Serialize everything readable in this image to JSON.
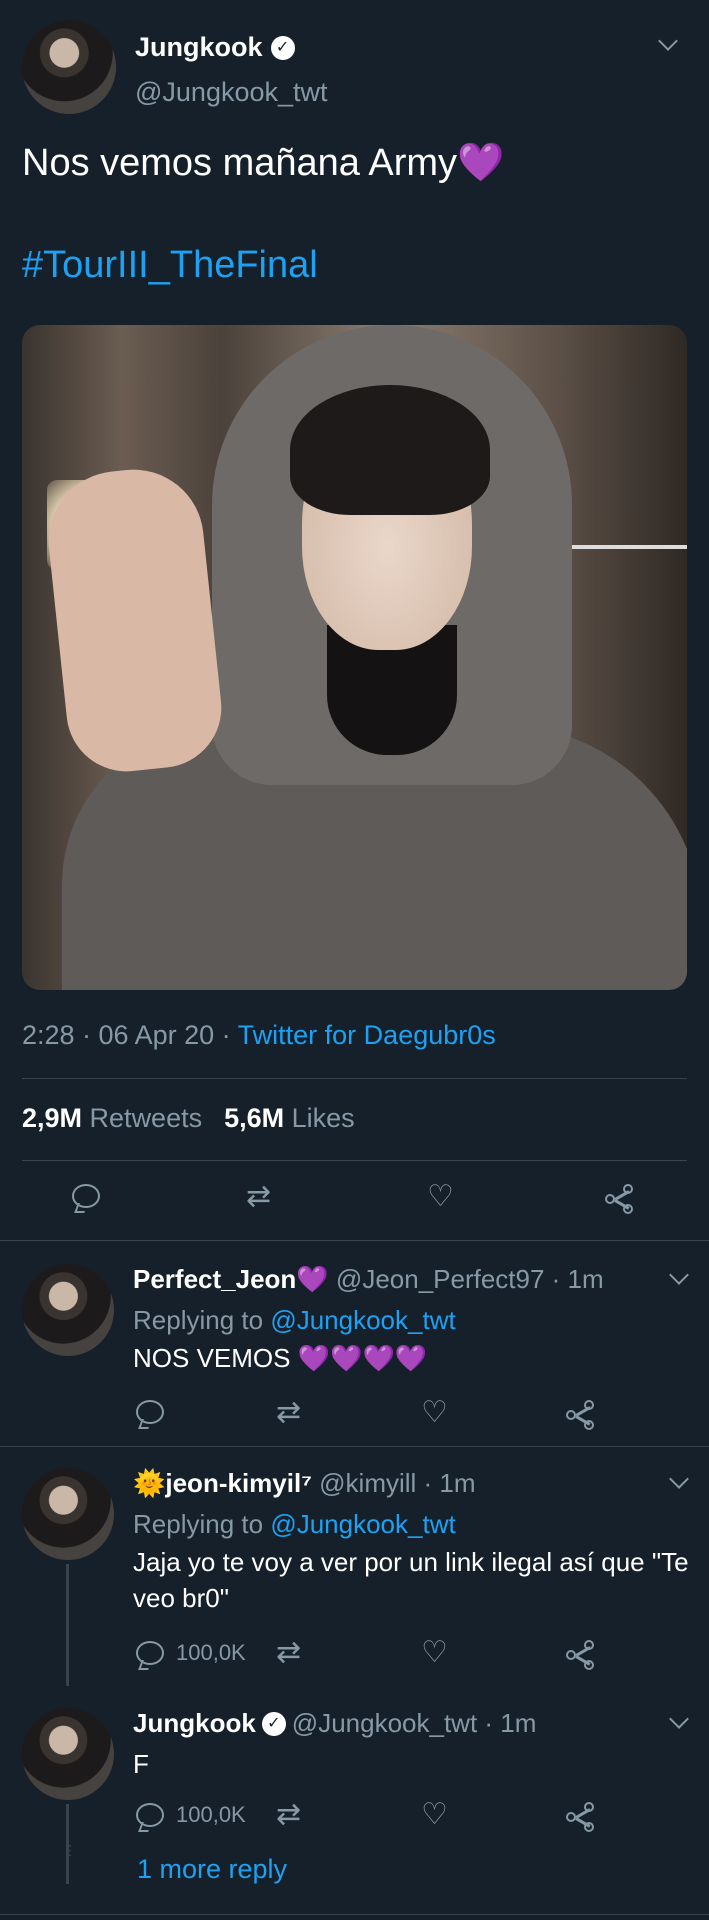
{
  "main_tweet": {
    "name": "Jungkook",
    "handle": "@Jungkook_twt",
    "text": "Nos vemos mañana Army",
    "emoji": "💜",
    "hashtag": "#TourIII_TheFinal",
    "time": "2:28 · 06 Apr 20 · ",
    "source": "Twitter for Daegubr0s",
    "retweets_count": "2,9M",
    "retweets_label": "Retweets",
    "likes_count": "5,6M",
    "likes_label": "Likes"
  },
  "replies": [
    {
      "name": "Perfect_Jeon💜",
      "handle": "@Jeon_Perfect97 · 1m",
      "replying_prefix": "Replying to ",
      "replying_to": "@Jungkook_twt",
      "text": "NOS VEMOS 💜💜💜💜",
      "reply_count": ""
    },
    {
      "name": "🌞jeon-kimyil⁷",
      "handle": "@kimyill · 1m",
      "replying_prefix": "Replying to ",
      "replying_to": "@Jungkook_twt",
      "text": "Jaja yo te voy a ver por un link ilegal así que \"Te veo br0\"",
      "reply_count": "100,0K"
    },
    {
      "name": "Jungkook",
      "handle": "@Jungkook_twt · 1m",
      "text": "F",
      "reply_count": "100,0K"
    }
  ],
  "more_reply": "1 more reply",
  "icons": {
    "reply": "reply-icon",
    "retweet": "retweet-icon",
    "like": "heart-icon",
    "share": "share-icon",
    "verified": "verified-badge-icon",
    "menu": "chevron-down-icon"
  },
  "colors": {
    "background": "#15202b",
    "link": "#1da1f2",
    "secondary": "#8899a6",
    "divider": "#38444d"
  }
}
